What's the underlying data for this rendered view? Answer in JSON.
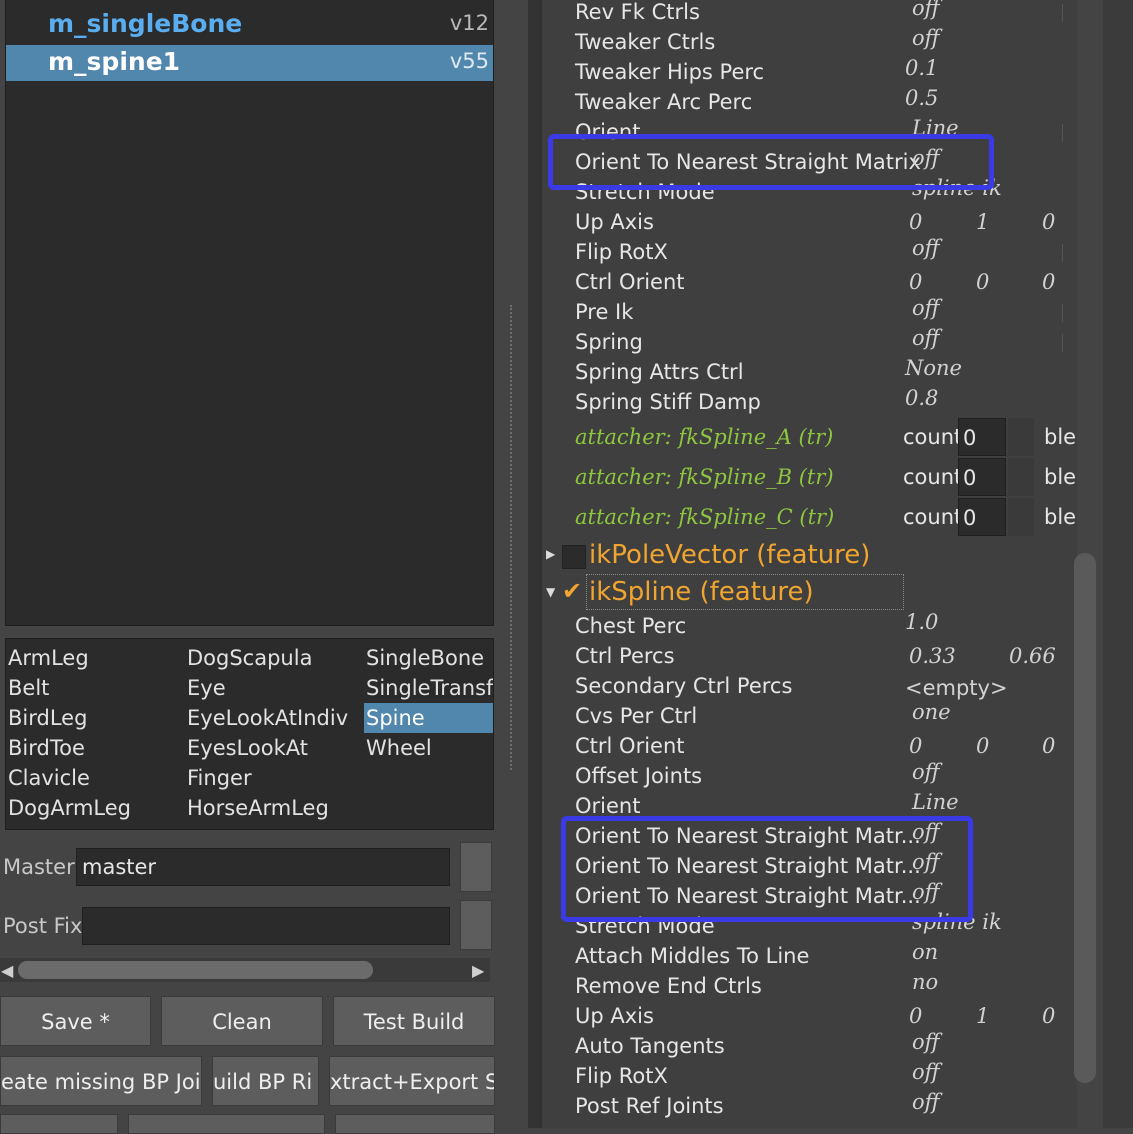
{
  "outliner": {
    "rows": [
      {
        "name": "m_singleBone",
        "version": "v12"
      },
      {
        "name": "m_spine1",
        "version": "v55"
      }
    ]
  },
  "modules": {
    "col1": [
      "ArmLeg",
      "Belt",
      "BirdLeg",
      "BirdToe",
      "Clavicle",
      "DogArmLeg"
    ],
    "col2": [
      "DogScapula",
      "Eye",
      "EyeLookAtIndiv",
      "EyesLookAt",
      "Finger",
      "HorseArmLeg"
    ],
    "col3": [
      "SingleBone",
      "SingleTransfo",
      "Spine",
      "Wheel"
    ],
    "selected": "Spine"
  },
  "fields": {
    "master_label": "Master",
    "master_value": "master",
    "postfix_label": "Post Fix",
    "postfix_value": ""
  },
  "buttons": {
    "save": "Save *",
    "clean": "Clean",
    "test_build": "Test Build",
    "create_missing": "eate missing BP Join",
    "build_bp": "uild BP Ri",
    "extract_export": "xtract+Export Sk"
  },
  "attrs_top": [
    {
      "label": "Rev Fk Ctrls",
      "value": "off"
    },
    {
      "label": "Tweaker Ctrls",
      "value": "off"
    },
    {
      "label": "Tweaker Hips Perc",
      "value": "0.1"
    },
    {
      "label": "Tweaker Arc Perc",
      "value": "0.5"
    },
    {
      "label": "Orient",
      "value": "Line"
    },
    {
      "label": "Orient To Nearest Straight Matrix",
      "value": "off"
    },
    {
      "label": "Stretch Mode",
      "value": "spline ik"
    },
    {
      "label": "Up Axis",
      "value": [
        "0",
        "1",
        "0"
      ]
    },
    {
      "label": "Flip RotX",
      "value": "off"
    },
    {
      "label": "Ctrl Orient",
      "value": [
        "0",
        "0",
        "0"
      ]
    },
    {
      "label": "Pre Ik",
      "value": "off"
    },
    {
      "label": "Spring",
      "value": "off"
    },
    {
      "label": "Spring Attrs Ctrl",
      "value": "None"
    },
    {
      "label": "Spring Stiff Damp",
      "value": "0.8"
    }
  ],
  "attachers": [
    {
      "label": "attacher: fkSpline_A (tr)",
      "count_label": "count",
      "count": "0",
      "tail": "ble"
    },
    {
      "label": "attacher: fkSpline_B (tr)",
      "count_label": "count",
      "count": "0",
      "tail": "ble"
    },
    {
      "label": "attacher: fkSpline_C (tr)",
      "count_label": "count",
      "count": "0",
      "tail": "ble"
    }
  ],
  "features": [
    {
      "label": "ikPoleVector (feature)",
      "checked": false,
      "expanded": false
    },
    {
      "label": "ikSpline (feature)",
      "checked": true,
      "expanded": true
    }
  ],
  "attrs_bottom": [
    {
      "label": "Chest Perc",
      "value": "1.0"
    },
    {
      "label": "Ctrl Percs",
      "value": [
        "0.33",
        "0.66"
      ]
    },
    {
      "label": "Secondary Ctrl Percs",
      "value": "<empty>"
    },
    {
      "label": "Cvs Per Ctrl",
      "value": "one"
    },
    {
      "label": "Ctrl Orient",
      "value": [
        "0",
        "0",
        "0"
      ]
    },
    {
      "label": "Offset Joints",
      "value": "off"
    },
    {
      "label": "Orient",
      "value": "Line"
    },
    {
      "label": "Orient To Nearest Straight Matr...",
      "value": "off"
    },
    {
      "label": "Orient To Nearest Straight Matr...",
      "value": "off"
    },
    {
      "label": "Orient To Nearest Straight Matr...",
      "value": "off"
    },
    {
      "label": "Stretch Mode",
      "value": "spline ik"
    },
    {
      "label": "Attach Middles To Line",
      "value": "on"
    },
    {
      "label": "Remove End Ctrls",
      "value": "no"
    },
    {
      "label": "Up Axis",
      "value": [
        "0",
        "1",
        "0"
      ]
    },
    {
      "label": "Auto Tangents",
      "value": "off"
    },
    {
      "label": "Flip RotX",
      "value": "off"
    },
    {
      "label": "Post Ref Joints",
      "value": "off"
    }
  ],
  "colors": {
    "highlight_box": "#3a3ae6",
    "selection": "#5186ad",
    "feature_label": "#f0a530",
    "attacher_label": "#8dc63f"
  }
}
